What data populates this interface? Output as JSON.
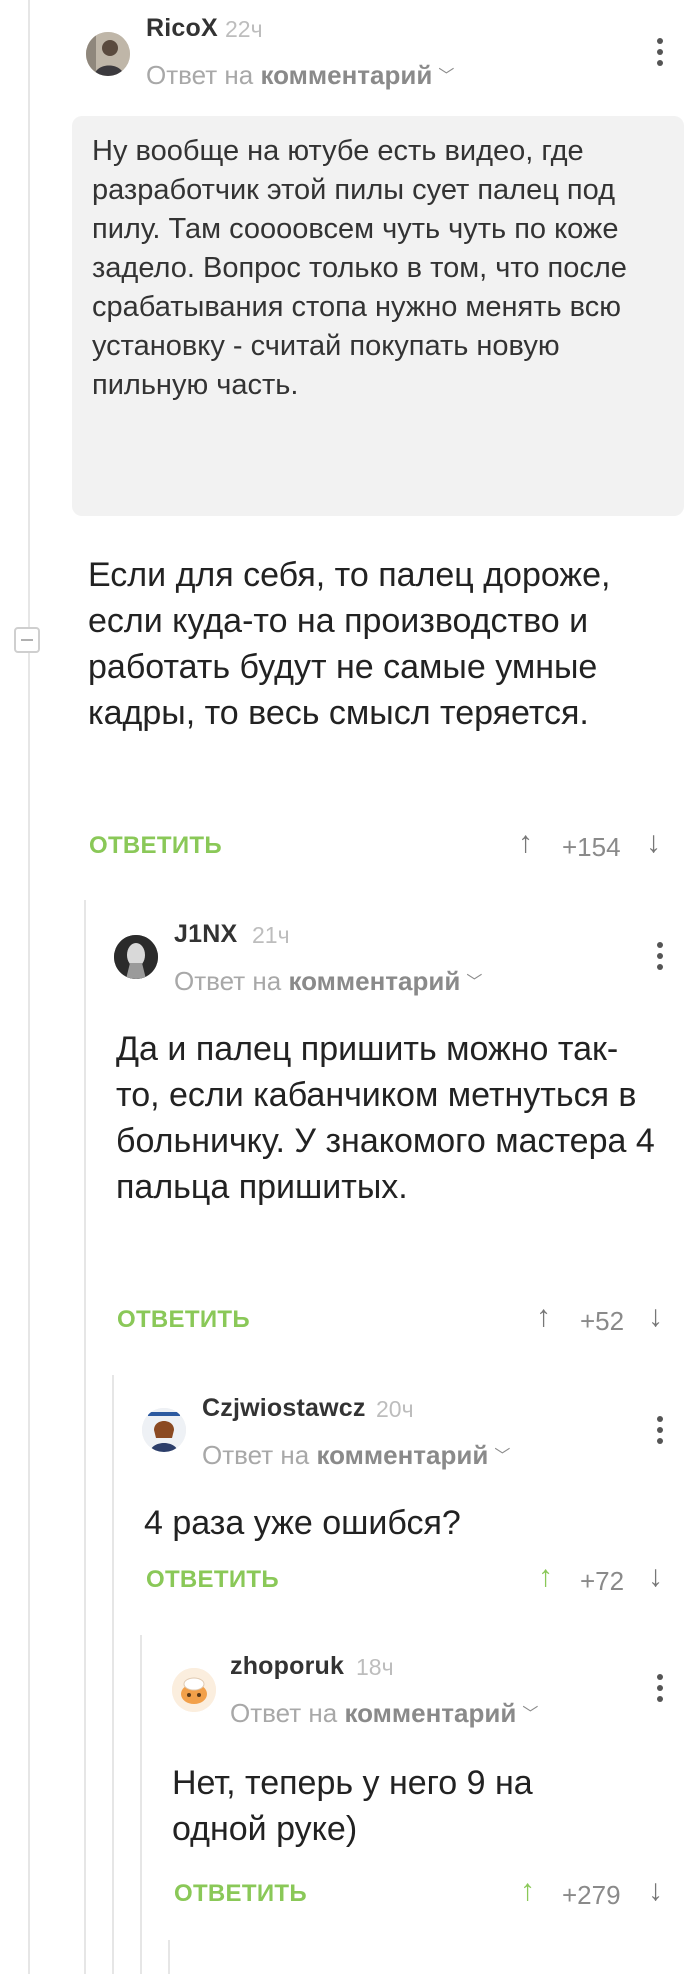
{
  "comments": [
    {
      "author": "RicoX",
      "time": "22ч",
      "reply_prefix": "Ответ на",
      "reply_target": "комментарий",
      "quote": "Ну вообще на ютубе есть видео, где разработчик этой пилы сует палец под пилу. Там соооовсем чуть чуть по коже задело. Вопрос только в том, что после срабатывания стопа нужно менять всю установку - считай покупать новую пильную часть.",
      "text": "Если для себя, то палец дороже, если куда-то на производство и работать будут не самые умные кадры, то весь смысл теряется.",
      "reply_label": "ОТВЕТИТЬ",
      "rating": "+154",
      "upvoted": false
    },
    {
      "author": "J1NX",
      "time": "21ч",
      "reply_prefix": "Ответ на",
      "reply_target": "комментарий",
      "text": "Да и палец пришить можно так-то, если кабанчиком метнуться в больничку. У знакомого мастера 4 пальца пришитых.",
      "reply_label": "ОТВЕТИТЬ",
      "rating": "+52",
      "upvoted": false
    },
    {
      "author": "Czjwiostawcz",
      "time": "20ч",
      "reply_prefix": "Ответ на",
      "reply_target": "комментарий",
      "text": "4 раза уже ошибся?",
      "reply_label": "ОТВЕТИТЬ",
      "rating": "+72",
      "upvoted": true
    },
    {
      "author": "zhoporuk",
      "time": "18ч",
      "reply_prefix": "Ответ на",
      "reply_target": "комментарий",
      "text": "Нет, теперь у него 9 на одной руке)",
      "reply_label": "ОТВЕТИТЬ",
      "rating": "+279",
      "upvoted": true
    }
  ],
  "icons": {
    "up": "arrow-up-icon",
    "down": "arrow-down-icon",
    "menu": "more-vertical-icon",
    "collapse": "collapse-thread-icon"
  },
  "colors": {
    "accent_green": "#8ac858",
    "quote_bg": "#f2f2f2",
    "thread_line": "#e6e6e6"
  }
}
